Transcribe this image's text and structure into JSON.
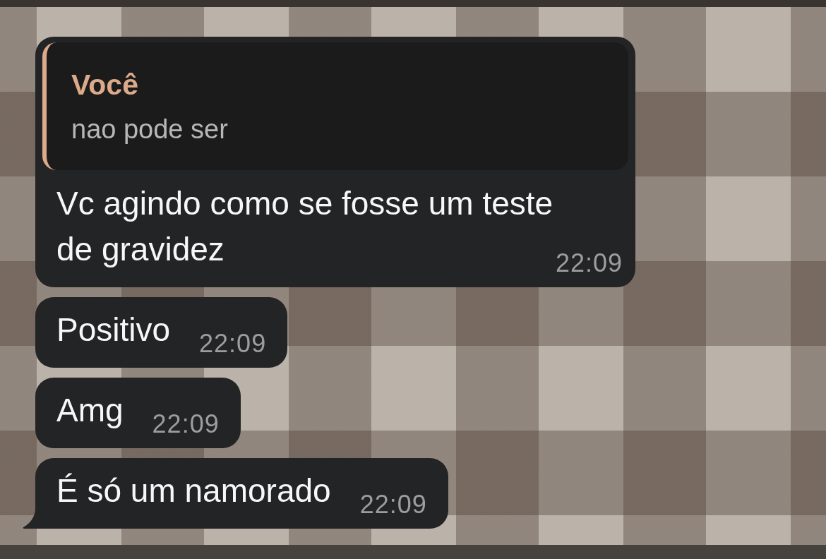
{
  "messages": [
    {
      "reply": {
        "author": "Você",
        "text": "nao pode ser"
      },
      "text": "Vc agindo como se fosse um teste de gravidez",
      "time": "22:09",
      "tail": false
    },
    {
      "text": "Positivo",
      "time": "22:09",
      "tail": false
    },
    {
      "text": "Amg",
      "time": "22:09",
      "tail": false
    },
    {
      "text": "É só um namorado",
      "time": "22:09",
      "tail": true
    }
  ]
}
